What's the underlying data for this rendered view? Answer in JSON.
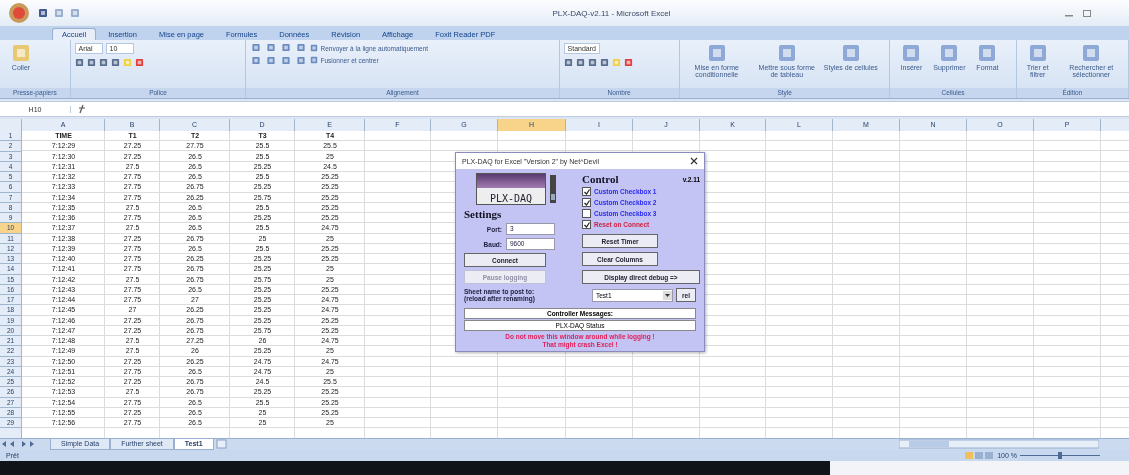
{
  "window": {
    "title": "PLX-DAQ-v2.11 - Microsoft Excel"
  },
  "ribbon_tabs": [
    {
      "label": "Accueil",
      "selected": true
    },
    {
      "label": "Insertion",
      "selected": false
    },
    {
      "label": "Mise en page",
      "selected": false
    },
    {
      "label": "Formules",
      "selected": false
    },
    {
      "label": "Données",
      "selected": false
    },
    {
      "label": "Révision",
      "selected": false
    },
    {
      "label": "Affichage",
      "selected": false
    },
    {
      "label": "Foxit Reader PDF",
      "selected": false
    }
  ],
  "ribbon_groups": [
    {
      "label": "Presse-papiers",
      "items": [
        {
          "kind": "large",
          "label": "Coller"
        }
      ]
    },
    {
      "label": "Police",
      "items": [
        {
          "kind": "field",
          "label": "Arial"
        },
        {
          "kind": "field",
          "label": "10"
        }
      ]
    },
    {
      "label": "Alignement",
      "items": [
        {
          "kind": "small",
          "label": "Renvoyer à la ligne automatiquement"
        },
        {
          "kind": "small",
          "label": "Fusionner et centrer"
        }
      ]
    },
    {
      "label": "Nombre",
      "items": [
        {
          "kind": "field",
          "label": "Standard"
        }
      ]
    },
    {
      "label": "Style",
      "items": [
        {
          "kind": "large",
          "label": "Mise en forme conditionnelle"
        },
        {
          "kind": "large",
          "label": "Mettre sous forme de tableau"
        },
        {
          "kind": "large",
          "label": "Styles de cellules"
        }
      ]
    },
    {
      "label": "Cellules",
      "items": [
        {
          "kind": "large",
          "label": "Insérer"
        },
        {
          "kind": "large",
          "label": "Supprimer"
        },
        {
          "kind": "large",
          "label": "Format"
        }
      ]
    },
    {
      "label": "Édition",
      "items": [
        {
          "kind": "large",
          "label": "Trier et filtrer"
        },
        {
          "kind": "large",
          "label": "Rechercher et sélectionner"
        }
      ]
    }
  ],
  "name_box": "H10",
  "columns": [
    {
      "label": "A",
      "selected": false
    },
    {
      "label": "B",
      "selected": false
    },
    {
      "label": "C",
      "selected": false
    },
    {
      "label": "D",
      "selected": false
    },
    {
      "label": "E",
      "selected": false
    },
    {
      "label": "F",
      "selected": false
    },
    {
      "label": "G",
      "selected": false
    },
    {
      "label": "H",
      "selected": true
    },
    {
      "label": "I",
      "selected": false
    },
    {
      "label": "J",
      "selected": false
    },
    {
      "label": "K",
      "selected": false
    },
    {
      "label": "L",
      "selected": false
    },
    {
      "label": "M",
      "selected": false
    },
    {
      "label": "N",
      "selected": false
    },
    {
      "label": "O",
      "selected": false
    },
    {
      "label": "P",
      "selected": false
    }
  ],
  "rows": [
    {
      "number": "1",
      "selected": false,
      "kind": "header",
      "cells": [
        "TIME",
        "T1",
        "T2",
        "T3",
        "T4"
      ]
    },
    {
      "number": "2",
      "selected": false,
      "kind": "data",
      "cells": [
        "7:12:29",
        "27.25",
        "27.75",
        "25.5",
        "25.5"
      ]
    },
    {
      "number": "3",
      "selected": false,
      "kind": "data",
      "cells": [
        "7:12:30",
        "27.25",
        "26.5",
        "25.5",
        "25"
      ]
    },
    {
      "number": "4",
      "selected": false,
      "kind": "data",
      "cells": [
        "7:12:31",
        "27.5",
        "26.5",
        "25.25",
        "24.5"
      ]
    },
    {
      "number": "5",
      "selected": false,
      "kind": "data",
      "cells": [
        "7:12:32",
        "27.75",
        "26.5",
        "25.5",
        "25.25"
      ]
    },
    {
      "number": "6",
      "selected": false,
      "kind": "data",
      "cells": [
        "7:12:33",
        "27.75",
        "26.75",
        "25.25",
        "25.25"
      ]
    },
    {
      "number": "7",
      "selected": false,
      "kind": "data",
      "cells": [
        "7:12:34",
        "27.75",
        "26.25",
        "25.75",
        "25.25"
      ]
    },
    {
      "number": "8",
      "selected": false,
      "kind": "data",
      "cells": [
        "7:12:35",
        "27.5",
        "26.5",
        "25.5",
        "25.25"
      ]
    },
    {
      "number": "9",
      "selected": false,
      "kind": "data",
      "cells": [
        "7:12:36",
        "27.75",
        "26.5",
        "25.25",
        "25.25"
      ]
    },
    {
      "number": "10",
      "selected": true,
      "kind": "data",
      "cells": [
        "7:12:37",
        "27.5",
        "26.5",
        "25.5",
        "24.75"
      ]
    },
    {
      "number": "11",
      "selected": false,
      "kind": "data",
      "cells": [
        "7:12:38",
        "27.25",
        "26.75",
        "25",
        "25"
      ]
    },
    {
      "number": "12",
      "selected": false,
      "kind": "data",
      "cells": [
        "7:12:39",
        "27.75",
        "26.5",
        "25.5",
        "25.25"
      ]
    },
    {
      "number": "13",
      "selected": false,
      "kind": "data",
      "cells": [
        "7:12:40",
        "27.75",
        "26.25",
        "25.25",
        "25.25"
      ]
    },
    {
      "number": "14",
      "selected": false,
      "kind": "data",
      "cells": [
        "7:12:41",
        "27.75",
        "26.75",
        "25.25",
        "25"
      ]
    },
    {
      "number": "15",
      "selected": false,
      "kind": "data",
      "cells": [
        "7:12:42",
        "27.5",
        "26.75",
        "25.75",
        "25"
      ]
    },
    {
      "number": "16",
      "selected": false,
      "kind": "data",
      "cells": [
        "7:12:43",
        "27.75",
        "26.5",
        "25.25",
        "25.25"
      ]
    },
    {
      "number": "17",
      "selected": false,
      "kind": "data",
      "cells": [
        "7:12:44",
        "27.75",
        "27",
        "25.25",
        "24.75"
      ]
    },
    {
      "number": "18",
      "selected": false,
      "kind": "data",
      "cells": [
        "7:12:45",
        "27",
        "26.25",
        "25.25",
        "24.75"
      ]
    },
    {
      "number": "19",
      "selected": false,
      "kind": "data",
      "cells": [
        "7:12:46",
        "27.25",
        "26.75",
        "25.25",
        "25.25"
      ]
    },
    {
      "number": "20",
      "selected": false,
      "kind": "data",
      "cells": [
        "7:12:47",
        "27.25",
        "26.75",
        "25.75",
        "25.25"
      ]
    },
    {
      "number": "21",
      "selected": false,
      "kind": "data",
      "cells": [
        "7:12:48",
        "27.5",
        "27.25",
        "26",
        "24.75"
      ]
    },
    {
      "number": "22",
      "selected": false,
      "kind": "data",
      "cells": [
        "7:12:49",
        "27.5",
        "26",
        "25.25",
        "25"
      ]
    },
    {
      "number": "23",
      "selected": false,
      "kind": "data",
      "cells": [
        "7:12:50",
        "27.25",
        "26.25",
        "24.75",
        "24.75"
      ]
    },
    {
      "number": "24",
      "selected": false,
      "kind": "data",
      "cells": [
        "7:12:51",
        "27.75",
        "26.5",
        "24.75",
        "25"
      ]
    },
    {
      "number": "25",
      "selected": false,
      "kind": "data",
      "cells": [
        "7:12:52",
        "27.25",
        "26.75",
        "24.5",
        "25.5"
      ]
    },
    {
      "number": "26",
      "selected": false,
      "kind": "data",
      "cells": [
        "7:12:53",
        "27.5",
        "26.75",
        "25.25",
        "25.25"
      ]
    },
    {
      "number": "27",
      "selected": false,
      "kind": "data",
      "cells": [
        "7:12:54",
        "27.75",
        "26.5",
        "25.5",
        "25.25"
      ]
    },
    {
      "number": "28",
      "selected": false,
      "kind": "data",
      "cells": [
        "7:12:55",
        "27.25",
        "26.5",
        "25",
        "25.25"
      ]
    },
    {
      "number": "29",
      "selected": false,
      "kind": "data",
      "cells": [
        "7:12:56",
        "27.75",
        "26.5",
        "25",
        "25"
      ]
    }
  ],
  "sheet_tabs": [
    {
      "label": "Simple Data",
      "selected": false
    },
    {
      "label": "Further sheet",
      "selected": false
    },
    {
      "label": "Test1",
      "selected": true
    }
  ],
  "status_bar": {
    "text": "Prêt",
    "zoom": "100 %",
    "zoom_slider": {
      "level": 0.5
    }
  },
  "dialog": {
    "title": "PLX-DAQ for Excel \"Version 2\" by Net^Devil",
    "logo_text": "PLX-DAQ",
    "settings_heading": "Settings",
    "fields": [
      {
        "label": "Port:",
        "value": "3"
      },
      {
        "label": "Baud:",
        "value": "9600"
      }
    ],
    "left_buttons": [
      {
        "label": "Connect",
        "disabled": false
      },
      {
        "label": "Pause logging",
        "disabled": true
      }
    ],
    "control_heading": "Control",
    "version": "v.2.11",
    "checkboxes": [
      {
        "label": "Custom Checkbox 1",
        "checked": true,
        "color": "#2a2af0"
      },
      {
        "label": "Custom Checkbox 2",
        "checked": true,
        "color": "#2a2af0"
      },
      {
        "label": "Custom Checkbox 3",
        "checked": false,
        "color": "#2a2af0"
      },
      {
        "label": "Reset on Connect",
        "checked": true,
        "color": "#d02040"
      }
    ],
    "right_buttons": [
      {
        "label": "Reset Timer",
        "disabled": false
      },
      {
        "label": "Clear Columns",
        "disabled": false
      }
    ],
    "debug_button": "Display direct debug =>",
    "sheet_label": "Sheet name to post to:\n(reload after renaming)",
    "sheet_select": "Test1",
    "sheet_button": "rel",
    "messages_heading": "Controller Messages:",
    "messages_value": "PLX-DAQ Status",
    "warning": "Do not move this window around while logging !\nThat might crash Excel !"
  }
}
